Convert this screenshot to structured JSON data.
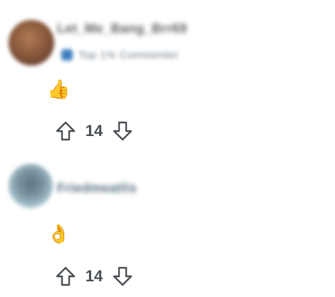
{
  "comments": [
    {
      "username": "Let_Me_Bang_Brr69",
      "flair_text": "Top 1% Commenter",
      "flair_icon": "badge-icon",
      "body_emoji": "👍",
      "score": "14",
      "upvote_icon": "arrow-up-icon",
      "downvote_icon": "arrow-down-icon"
    },
    {
      "username": "Friedmeatlis",
      "body_emoji": "👌",
      "score": "14",
      "upvote_icon": "arrow-up-icon",
      "downvote_icon": "arrow-down-icon"
    }
  ],
  "colors": {
    "icon_stroke": "#4a4f55",
    "flair_icon": "#3f7fc0",
    "background": "#ffffff"
  }
}
